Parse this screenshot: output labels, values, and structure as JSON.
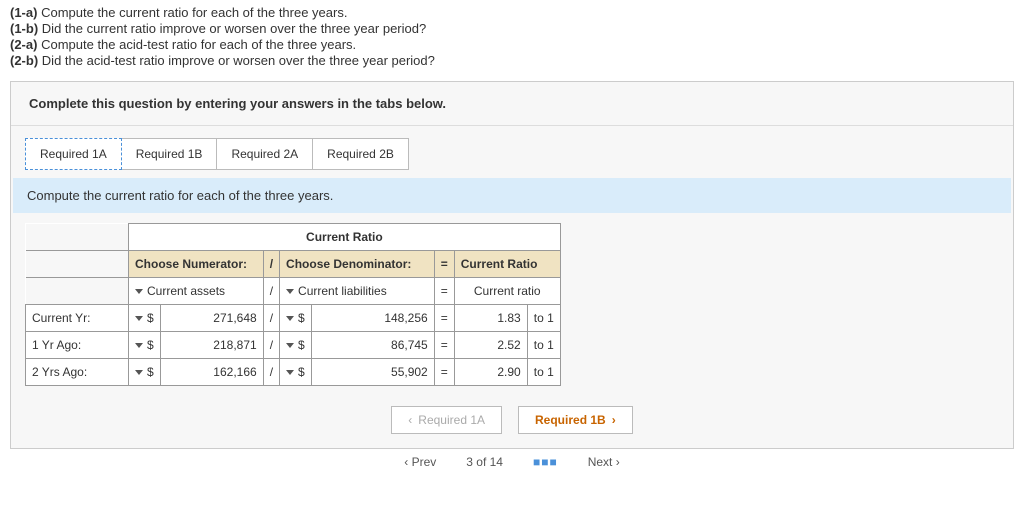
{
  "questions": [
    {
      "tag": "(1-a)",
      "text": "Compute the current ratio for each of the three years."
    },
    {
      "tag": "(1-b)",
      "text": "Did the current ratio improve or worsen over the three year period?"
    },
    {
      "tag": "(2-a)",
      "text": "Compute the acid-test ratio for each of the three years."
    },
    {
      "tag": "(2-b)",
      "text": "Did the acid-test ratio improve or worsen over the three year period?"
    }
  ],
  "panel_header": "Complete this question by entering your answers in the tabs below.",
  "tabs": [
    "Required 1A",
    "Required 1B",
    "Required 2A",
    "Required 2B"
  ],
  "instruction": "Compute the current ratio for each of the three years.",
  "table": {
    "title": "Current Ratio",
    "head": {
      "num": "Choose Numerator:",
      "div": "/",
      "den": "Choose Denominator:",
      "eq": "=",
      "res": "Current Ratio"
    },
    "sel": {
      "num": "Current assets",
      "div": "/",
      "den": "Current liabilities",
      "eq": "=",
      "res": "Current ratio"
    },
    "rows": [
      {
        "label": "Current Yr:",
        "cur1": "$",
        "v1": "271,648",
        "div": "/",
        "cur2": "$",
        "v2": "148,256",
        "eq": "=",
        "r": "1.83",
        "suf": "to 1"
      },
      {
        "label": "1 Yr Ago:",
        "cur1": "$",
        "v1": "218,871",
        "div": "/",
        "cur2": "$",
        "v2": "86,745",
        "eq": "=",
        "r": "2.52",
        "suf": "to 1"
      },
      {
        "label": "2 Yrs Ago:",
        "cur1": "$",
        "v1": "162,166",
        "div": "/",
        "cur2": "$",
        "v2": "55,902",
        "eq": "=",
        "r": "2.90",
        "suf": "to 1"
      }
    ]
  },
  "nav": {
    "prev": "Required 1A",
    "next": "Required 1B"
  },
  "footer": {
    "prev": "Prev",
    "pos": "3 of 14",
    "next": "Next"
  }
}
